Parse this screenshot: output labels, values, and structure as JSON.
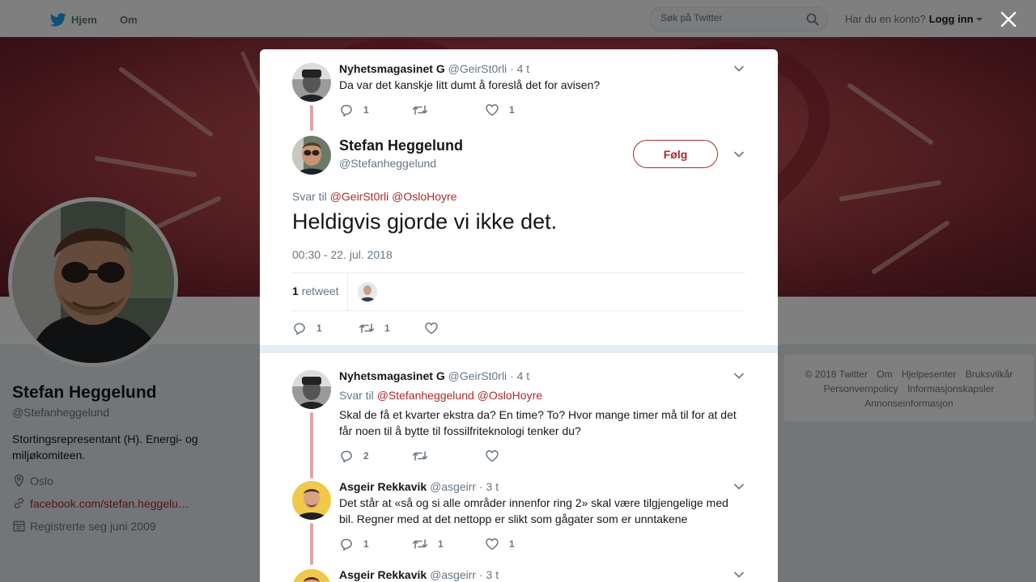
{
  "topbar": {
    "home_label": "Hjem",
    "about_label": "Om",
    "search_placeholder": "Søk på Twitter",
    "account_prompt": "Har du en konto?",
    "login_label": "Logg inn"
  },
  "profile": {
    "name": "Stefan Heggelund",
    "handle": "@Stefanheggelund",
    "bio": "Stortingsrepresentant (H). Energi- og miljøkomiteen.",
    "location": "Oslo",
    "link": "facebook.com/stefan.heggelu…",
    "joined": "Registrerte seg juni 2009"
  },
  "footer": {
    "copyright": "© 2018 Twitter",
    "about": "Om",
    "help": "Hjelpesenter",
    "terms": "Bruksvilkår",
    "privacy": "Personvernpolicy",
    "cookies": "Informasjonskapsler",
    "ads": "Annonseinformasjon"
  },
  "modal": {
    "parent": {
      "name": "Nyhetsmagasinet G",
      "handle": "@GeirSt0rli",
      "time": "· 4 t",
      "text": "Da var det kanskje litt dumt å foreslå det for avisen?",
      "replies": "1",
      "retweets": "",
      "likes": "1"
    },
    "main": {
      "name": "Stefan Heggelund",
      "handle": "@Stefanheggelund",
      "follow_label": "Følg",
      "reply_prefix": "Svar til",
      "mention1": "@GeirSt0rli",
      "mention2": "@OsloHoyre",
      "text": "Heldigvis gjorde vi ikke det.",
      "timestamp": "00:30 - 22. jul. 2018",
      "retweet_count": "1",
      "retweet_word": "retweet",
      "replies": "1",
      "retweets": "1",
      "likes": ""
    },
    "replies": [
      {
        "name": "Nyhetsmagasinet G",
        "handle": "@GeirSt0rli",
        "time": "· 4 t",
        "reply_prefix": "Svar til",
        "mention1": "@Stefanheggelund",
        "mention2": "@OsloHoyre",
        "text": "Skal de få et kvarter ekstra da? En time? To? Hvor mange timer må til for at det får noen til å bytte til fossilfriteknologi tenker du?",
        "replies": "2",
        "retweets": "",
        "likes": ""
      },
      {
        "name": "Asgeir Rekkavik",
        "handle": "@asgeirr",
        "time": "· 3 t",
        "text": "Det står at «så og si alle områder innenfor ring 2» skal være tilgjengelige med bil. Regner med at det nettopp er slikt som gågater som er unntakene",
        "replies": "1",
        "retweets": "1",
        "likes": "1"
      },
      {
        "name": "Asgeir Rekkavik",
        "handle": "@asgeirr",
        "time": "· 3 t"
      }
    ]
  },
  "colors": {
    "accent": "#ab2b2b",
    "thread_line": "#e0a3a3",
    "muted": "#657786"
  }
}
